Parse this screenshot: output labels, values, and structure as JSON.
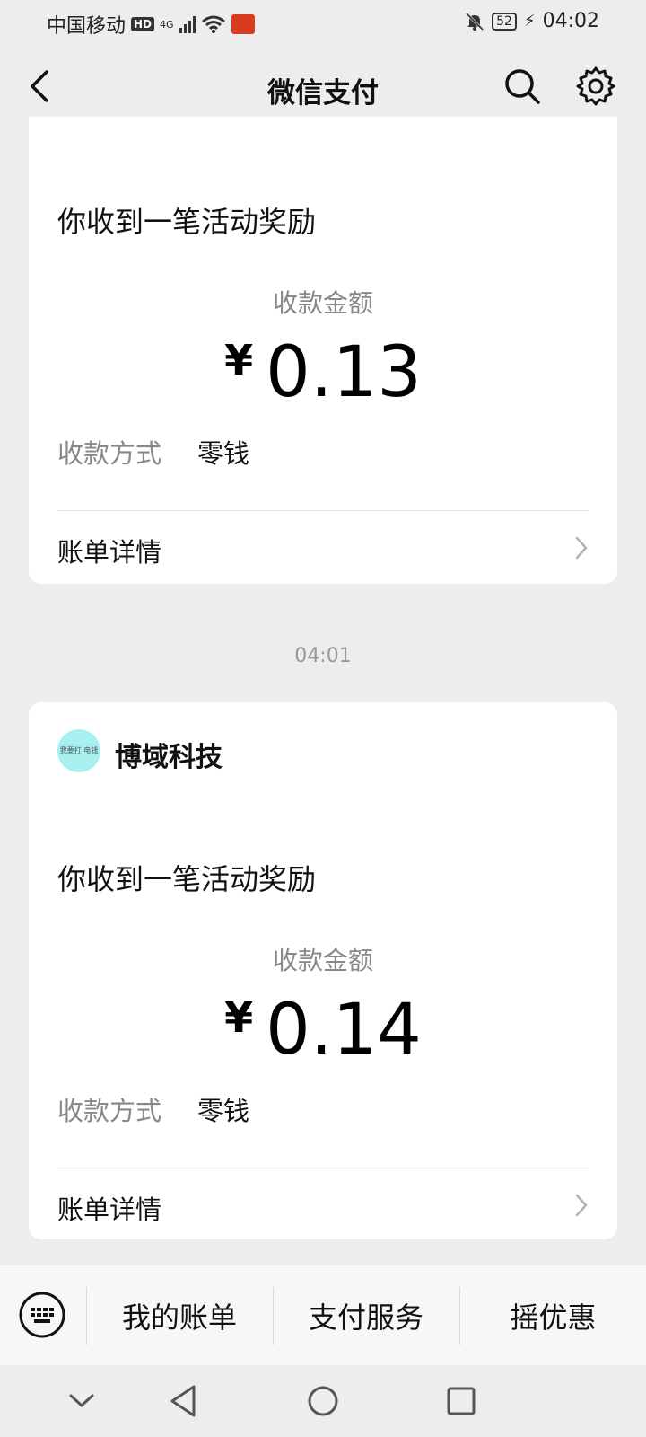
{
  "status_bar": {
    "carrier": "中国移动",
    "hd": "HD",
    "network": "4G",
    "battery": "52",
    "time": "04:02"
  },
  "header": {
    "title": "微信支付"
  },
  "messages": [
    {
      "headline": "你收到一笔活动奖励",
      "amount_label": "收款金额",
      "currency": "¥",
      "amount": "0.13",
      "method_label": "收款方式",
      "method_value": "零钱",
      "detail_label": "账单详情"
    },
    {
      "timestamp": "04:01",
      "merchant_name": "博域科技",
      "merchant_avatar_text": "我要打 电钱",
      "headline": "你收到一笔活动奖励",
      "amount_label": "收款金额",
      "currency": "¥",
      "amount": "0.14",
      "method_label": "收款方式",
      "method_value": "零钱",
      "detail_label": "账单详情"
    }
  ],
  "bottom_menu": {
    "items": [
      "我的账单",
      "支付服务",
      "摇优惠"
    ]
  },
  "icons": {
    "back": "chevron-left-icon",
    "search": "search-icon",
    "settings": "gear-icon",
    "keyboard": "keyboard-icon"
  }
}
